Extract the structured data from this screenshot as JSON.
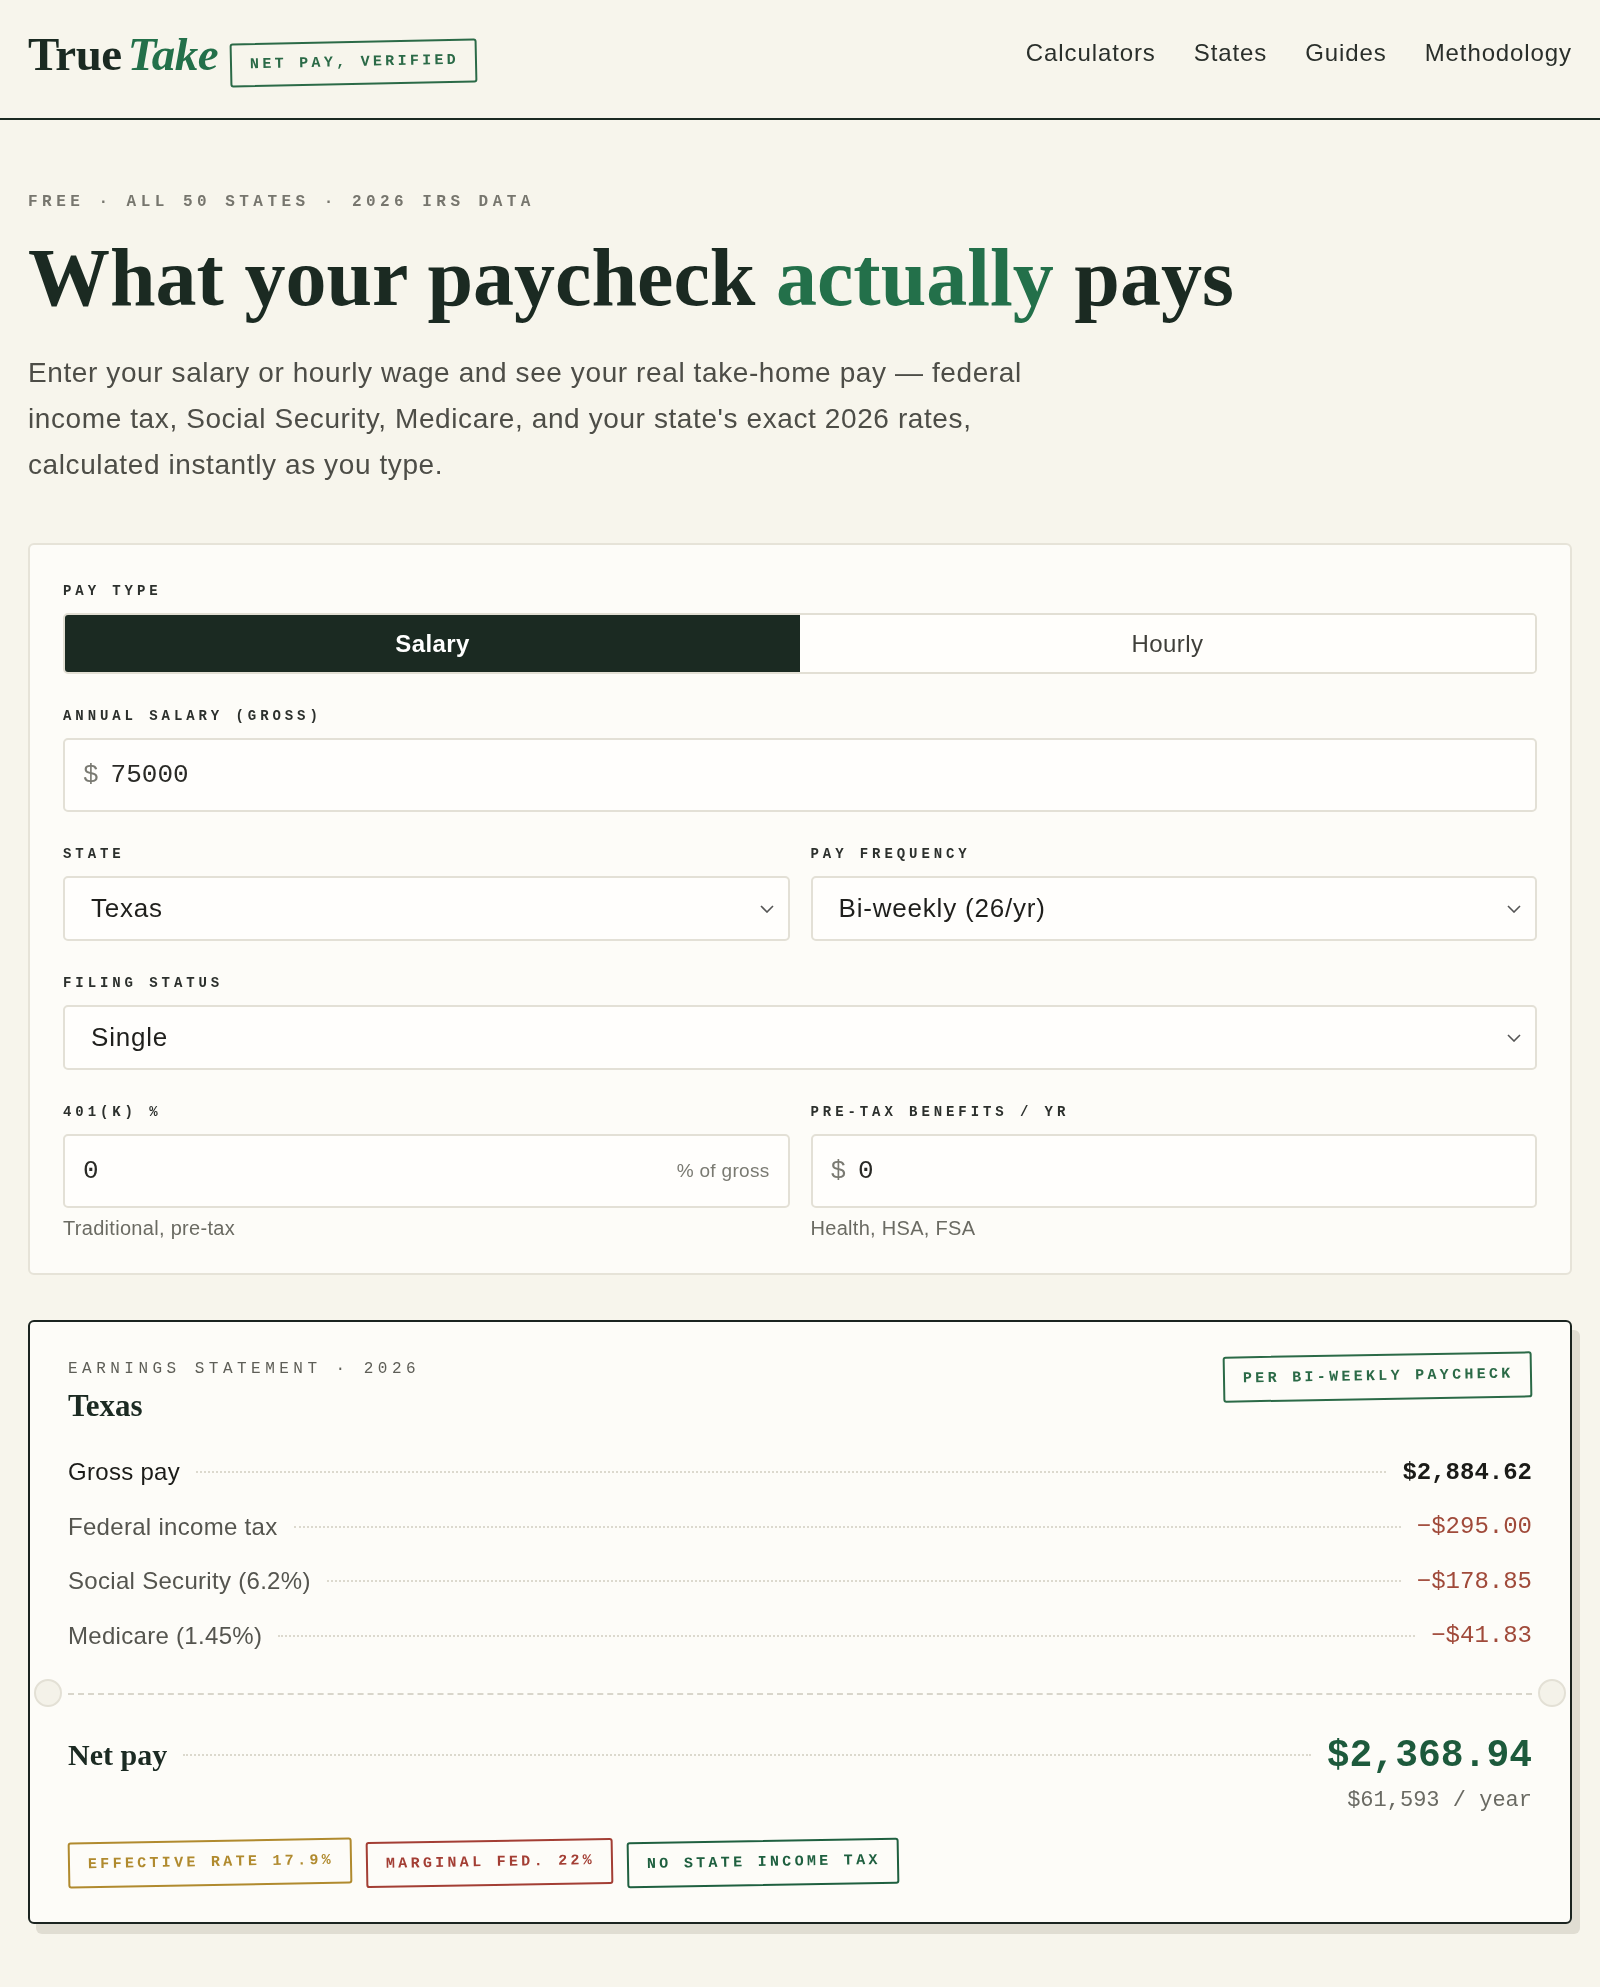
{
  "header": {
    "logo": {
      "text": "True",
      "accent": "Take"
    },
    "badge": "NET PAY, VERIFIED",
    "nav": [
      {
        "label": "Calculators"
      },
      {
        "label": "States"
      },
      {
        "label": "Guides"
      },
      {
        "label": "Methodology"
      }
    ]
  },
  "hero": {
    "eyebrow": "FREE · ALL 50 STATES · 2026 IRS DATA",
    "title": [
      {
        "text": "What your paycheck",
        "accent": false
      },
      {
        "text": "actually",
        "accent": true
      },
      {
        "text": "pays",
        "accent": false
      }
    ],
    "intro": "Enter your salary or hourly wage and see your real take-home pay — federal income tax, Social Security, Medicare, and your state's exact 2026 rates, calculated instantly as you type."
  },
  "calculator": {
    "pay_type": {
      "label": "PAY TYPE",
      "options": [
        {
          "label": "Salary",
          "selected": true
        },
        {
          "label": "Hourly",
          "selected": false
        }
      ]
    },
    "rows": [
      {
        "fields": [
          {
            "kind": "input",
            "label": "ANNUAL SALARY (GROSS)",
            "prefix": "$",
            "value": "75000"
          }
        ]
      },
      {
        "fields": [
          {
            "kind": "select",
            "label": "STATE",
            "value": "Texas"
          },
          {
            "kind": "select",
            "label": "PAY FREQUENCY",
            "value": "Bi-weekly (26/yr)"
          }
        ]
      },
      {
        "fields": [
          {
            "kind": "select",
            "label": "FILING STATUS",
            "value": "Single"
          }
        ]
      },
      {
        "fields": [
          {
            "kind": "input",
            "label": "401(K) %",
            "value": "0",
            "suffix": "% of gross",
            "hint": "Traditional, pre-tax"
          },
          {
            "kind": "input",
            "label": "PRE-TAX BENEFITS / YR",
            "prefix": "$",
            "value": "0",
            "hint": "Health, HSA, FSA"
          }
        ]
      }
    ]
  },
  "statement": {
    "eyebrow": "EARNINGS STATEMENT · 2026",
    "title": "Texas",
    "badge": "PER BI-WEEKLY PAYCHECK",
    "lines": [
      {
        "kind": "gross",
        "label": "Gross pay",
        "amount": "$2,884.62"
      },
      {
        "kind": "deduction",
        "label": "Federal income tax",
        "amount": "−$295.00"
      },
      {
        "kind": "deduction",
        "label": "Social Security (6.2%)",
        "amount": "−$178.85"
      },
      {
        "kind": "deduction",
        "label": "Medicare (1.45%)",
        "amount": "−$41.83"
      }
    ],
    "net": {
      "label": "Net pay",
      "amount": "$2,368.94",
      "annual": "$61,593 / year"
    },
    "tags": [
      {
        "text": "EFFECTIVE RATE 17.9%",
        "color": "#b08a2e"
      },
      {
        "text": "MARGINAL FED. 22%",
        "color": "#a33e34"
      },
      {
        "text": "NO STATE INCOME TAX",
        "color": "#1f6040"
      }
    ]
  }
}
